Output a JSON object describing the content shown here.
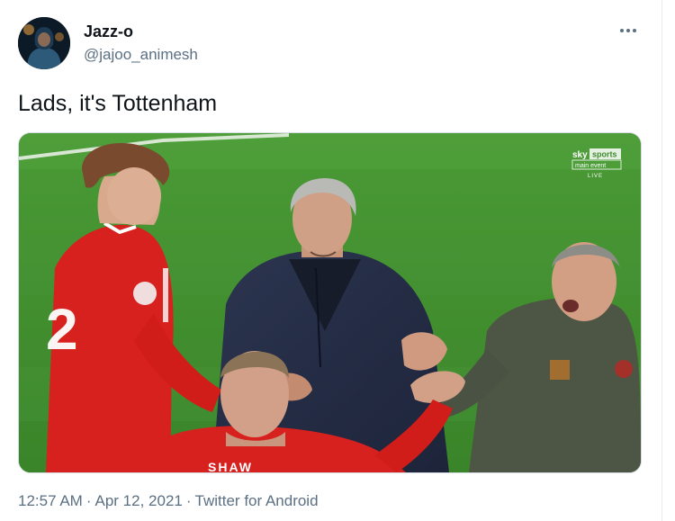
{
  "user": {
    "display_name": "Jazz-o",
    "handle": "@jajoo_animesh"
  },
  "tweet": {
    "text": "Lads, it's Tottenham",
    "time": "12:57 AM",
    "date": "Apr 12, 2021",
    "source": "Twitter for Android",
    "separator": "·"
  },
  "media": {
    "broadcaster": {
      "brand": "sky",
      "channel": "sports",
      "sub": "main event",
      "live": "LIVE"
    },
    "shirt_number": "2",
    "shirt_name": "SHAW"
  },
  "colors": {
    "handle": "#5b7083",
    "pitch": "#3f8a2f",
    "kit": "#d7211e"
  },
  "icons": {
    "more": "more-horizontal-icon"
  }
}
